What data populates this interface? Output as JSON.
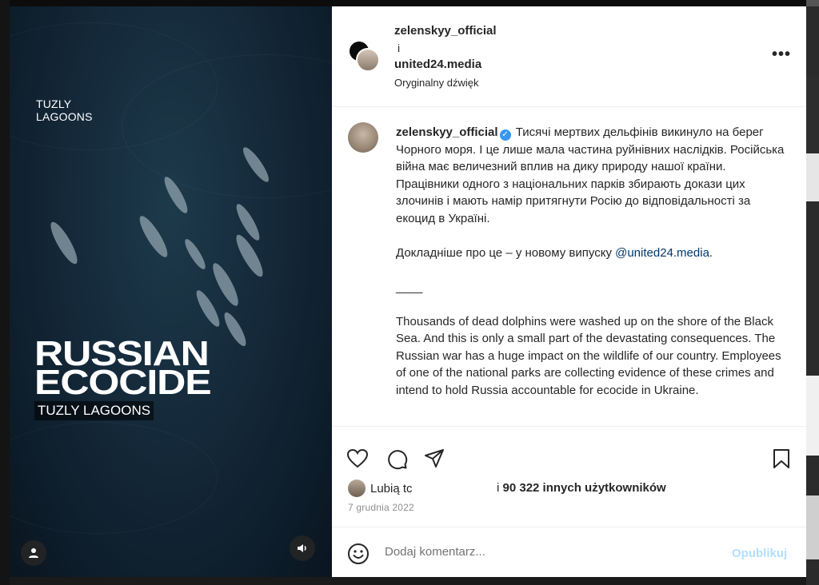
{
  "video": {
    "top_label_line1": "TUZLY",
    "top_label_line2": "LAGOONS",
    "title_line1": "RUSSIAN",
    "title_line2": "ECOCIDE",
    "subtitle": "TUZLY LAGOONS",
    "user_icon": "user-icon",
    "sound_icon": "speaker-icon"
  },
  "header": {
    "owner1": "zelenskyy_official",
    "separator": "i",
    "owner2": "united24.media",
    "audio_label": "Oryginalny dźwięk",
    "more_label": "•••"
  },
  "caption": {
    "username": "zelenskyy_official",
    "verified_icon": "verified-badge-icon",
    "ua_text": "Тисячі мертвих дельфінів викинуло на берег Чорного моря. І це лише мала частина руйнівних наслідків. Російська війна має величезний вплив на дику природу нашої країни. Працівники одного з національних парків збирають докази цих злочинів і мають намір притягнути Росію до відповідальності за екоцид в Україні.",
    "more_prefix": "Докладніше про це – у новому випуску ",
    "mention": "@united24.media",
    "more_suffix": ".",
    "divider": "____",
    "en_text": "Thousands of dead dolphins were washed up on the shore of the Black Sea. And this is only a small part of the devastating consequences. The Russian war has a huge impact on the wildlife of our country. Employees of one of the national parks are collecting evidence of these crimes and intend to hold Russia accountable for ecocide in Ukraine."
  },
  "actions": {
    "icons": [
      "heart-icon",
      "comment-icon",
      "share-icon",
      "bookmark-icon"
    ],
    "liked_by_label": "Lubią tc",
    "likes_prefix": "i ",
    "likes_count": "90 322 innych użytkowników",
    "date": "7 grudnia 2022"
  },
  "comment": {
    "emoji_icon": "emoji-icon",
    "placeholder": "Dodaj komentarz...",
    "publish_label": "Opublikuj"
  },
  "colors": {
    "text": "#262626",
    "link": "#00376b",
    "verified": "#3797f0",
    "publish_disabled": "#b2dffc",
    "muted": "#8e8e8e"
  }
}
